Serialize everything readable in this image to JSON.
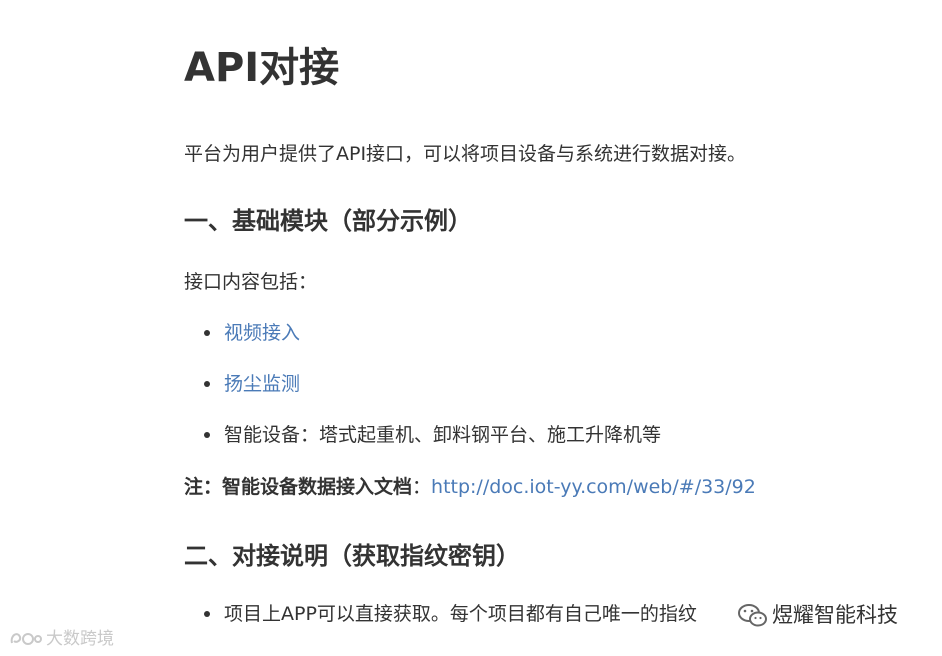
{
  "document": {
    "title": "API对接",
    "intro": "平台为用户提供了API接口，可以将项目设备与系统进行数据对接。",
    "section1": {
      "heading": "一、基础模块（部分示例）",
      "label": "接口内容包括：",
      "items": [
        {
          "text": "视频接入",
          "is_link": true
        },
        {
          "text": "扬尘监测",
          "is_link": true
        },
        {
          "text": "智能设备：塔式起重机、卸料钢平台、施工升降机等",
          "is_link": false
        }
      ],
      "note_label": "注：智能设备数据接入文档",
      "note_separator": "：",
      "note_link": "http://doc.iot-yy.com/web/#/33/92"
    },
    "section2": {
      "heading": "二、对接说明（获取指纹密钥）",
      "items": [
        {
          "text": "项目上APP可以直接获取。每个项目都有自己唯一的指纹"
        }
      ]
    }
  },
  "watermarks": {
    "left_text": "大数跨境",
    "right_text": "煜耀智能科技"
  },
  "colors": {
    "text": "#333333",
    "link": "#4a7ab7",
    "watermark": "#c9c9c9"
  }
}
